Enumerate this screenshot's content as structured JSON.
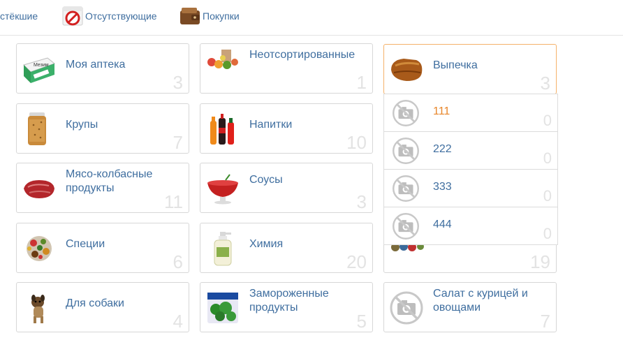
{
  "tabs": [
    {
      "label": "стёкшие"
    },
    {
      "label": "Отсутствующие"
    },
    {
      "label": "Покупки"
    }
  ],
  "categories": [
    {
      "name": "Моя аптека",
      "count": "3",
      "icon": "medicine-box-icon"
    },
    {
      "name": "Крупы",
      "count": "7",
      "icon": "grain-bag-icon"
    },
    {
      "name": "Мясо-колбасные продукты",
      "count": "11",
      "icon": "meat-icon"
    },
    {
      "name": "Специи",
      "count": "6",
      "icon": "spices-icon"
    },
    {
      "name": "Для собаки",
      "count": "4",
      "icon": "dog-icon"
    },
    {
      "name": "Неотсортированные",
      "count": "1",
      "icon": "groceries-icon"
    },
    {
      "name": "Напитки",
      "count": "10",
      "icon": "drinks-icon"
    },
    {
      "name": "Соусы",
      "count": "3",
      "icon": "sauce-bowl-icon"
    },
    {
      "name": "Химия",
      "count": "20",
      "icon": "soap-bottle-icon"
    },
    {
      "name": "Замороженные продукты",
      "count": "5",
      "icon": "frozen-broccoli-icon"
    },
    {
      "name": "Выпечка",
      "count": "3",
      "icon": "bread-icon"
    },
    {
      "name": "",
      "count": "19",
      "icon": "groceries-icon"
    },
    {
      "name": "Салат с курицей и овощами",
      "count": "7",
      "icon": "no-photo-icon"
    }
  ],
  "dropdown": {
    "items": [
      {
        "name": "111",
        "count": "0"
      },
      {
        "name": "222",
        "count": "0"
      },
      {
        "name": "333",
        "count": "0"
      },
      {
        "name": "444",
        "count": "0"
      }
    ]
  }
}
